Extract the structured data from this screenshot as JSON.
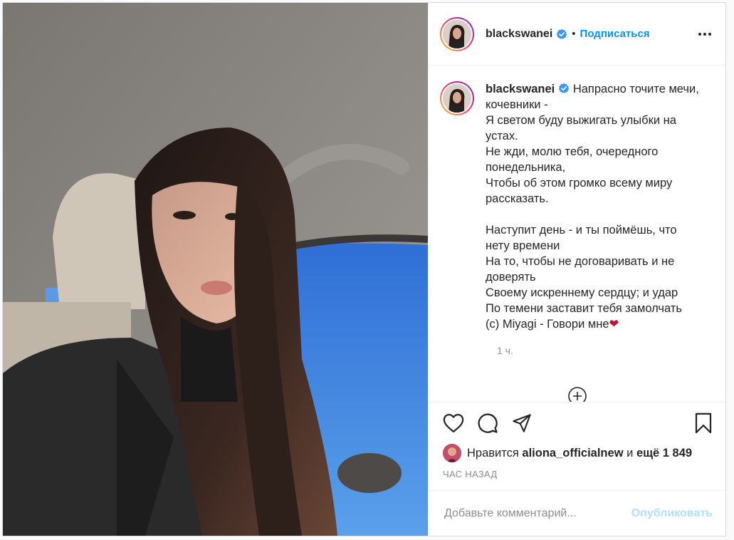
{
  "colors": {
    "accent": "#0095f6",
    "publish_disabled": "#b2dffc",
    "muted": "#8e8e8e",
    "text": "#262626",
    "border": "#dbdbdb"
  },
  "header": {
    "username": "blackswanei",
    "verified_icon": "verified-badge-icon",
    "separator": "•",
    "follow_label": "Подписаться",
    "more_icon": "more-options-icon"
  },
  "caption": {
    "username": "blackswanei",
    "text": "Напрасно точите мечи, кочевники -\nЯ светом буду выжигать улыбки на устах.\nНе жди, молю тебя, очередного понедельника,\nЧтобы об этом громко всему миру рассказать.\n\nНаступит день - и ты поймёшь, что нету времени\nНа то, чтобы не договаривать и не доверять\nСвоему искреннему сердцу; и удар\nПо темени заставит тебя замолчать\n(c) Miyagi - Говори мне",
    "emoji": "❤",
    "time": "1 ч."
  },
  "actions": {
    "like_icon": "heart-icon",
    "comment_icon": "comment-icon",
    "share_icon": "share-icon",
    "save_icon": "bookmark-icon",
    "load_more_icon": "plus-circle-icon"
  },
  "likes": {
    "prefix": "Нравится",
    "user": "aliona_officialnew",
    "middle": "и",
    "others": "ещё 1 849"
  },
  "timestamp": "ЧАС НАЗАД",
  "comment_box": {
    "placeholder": "Добавьте комментарий...",
    "publish_label": "Опубликовать"
  }
}
